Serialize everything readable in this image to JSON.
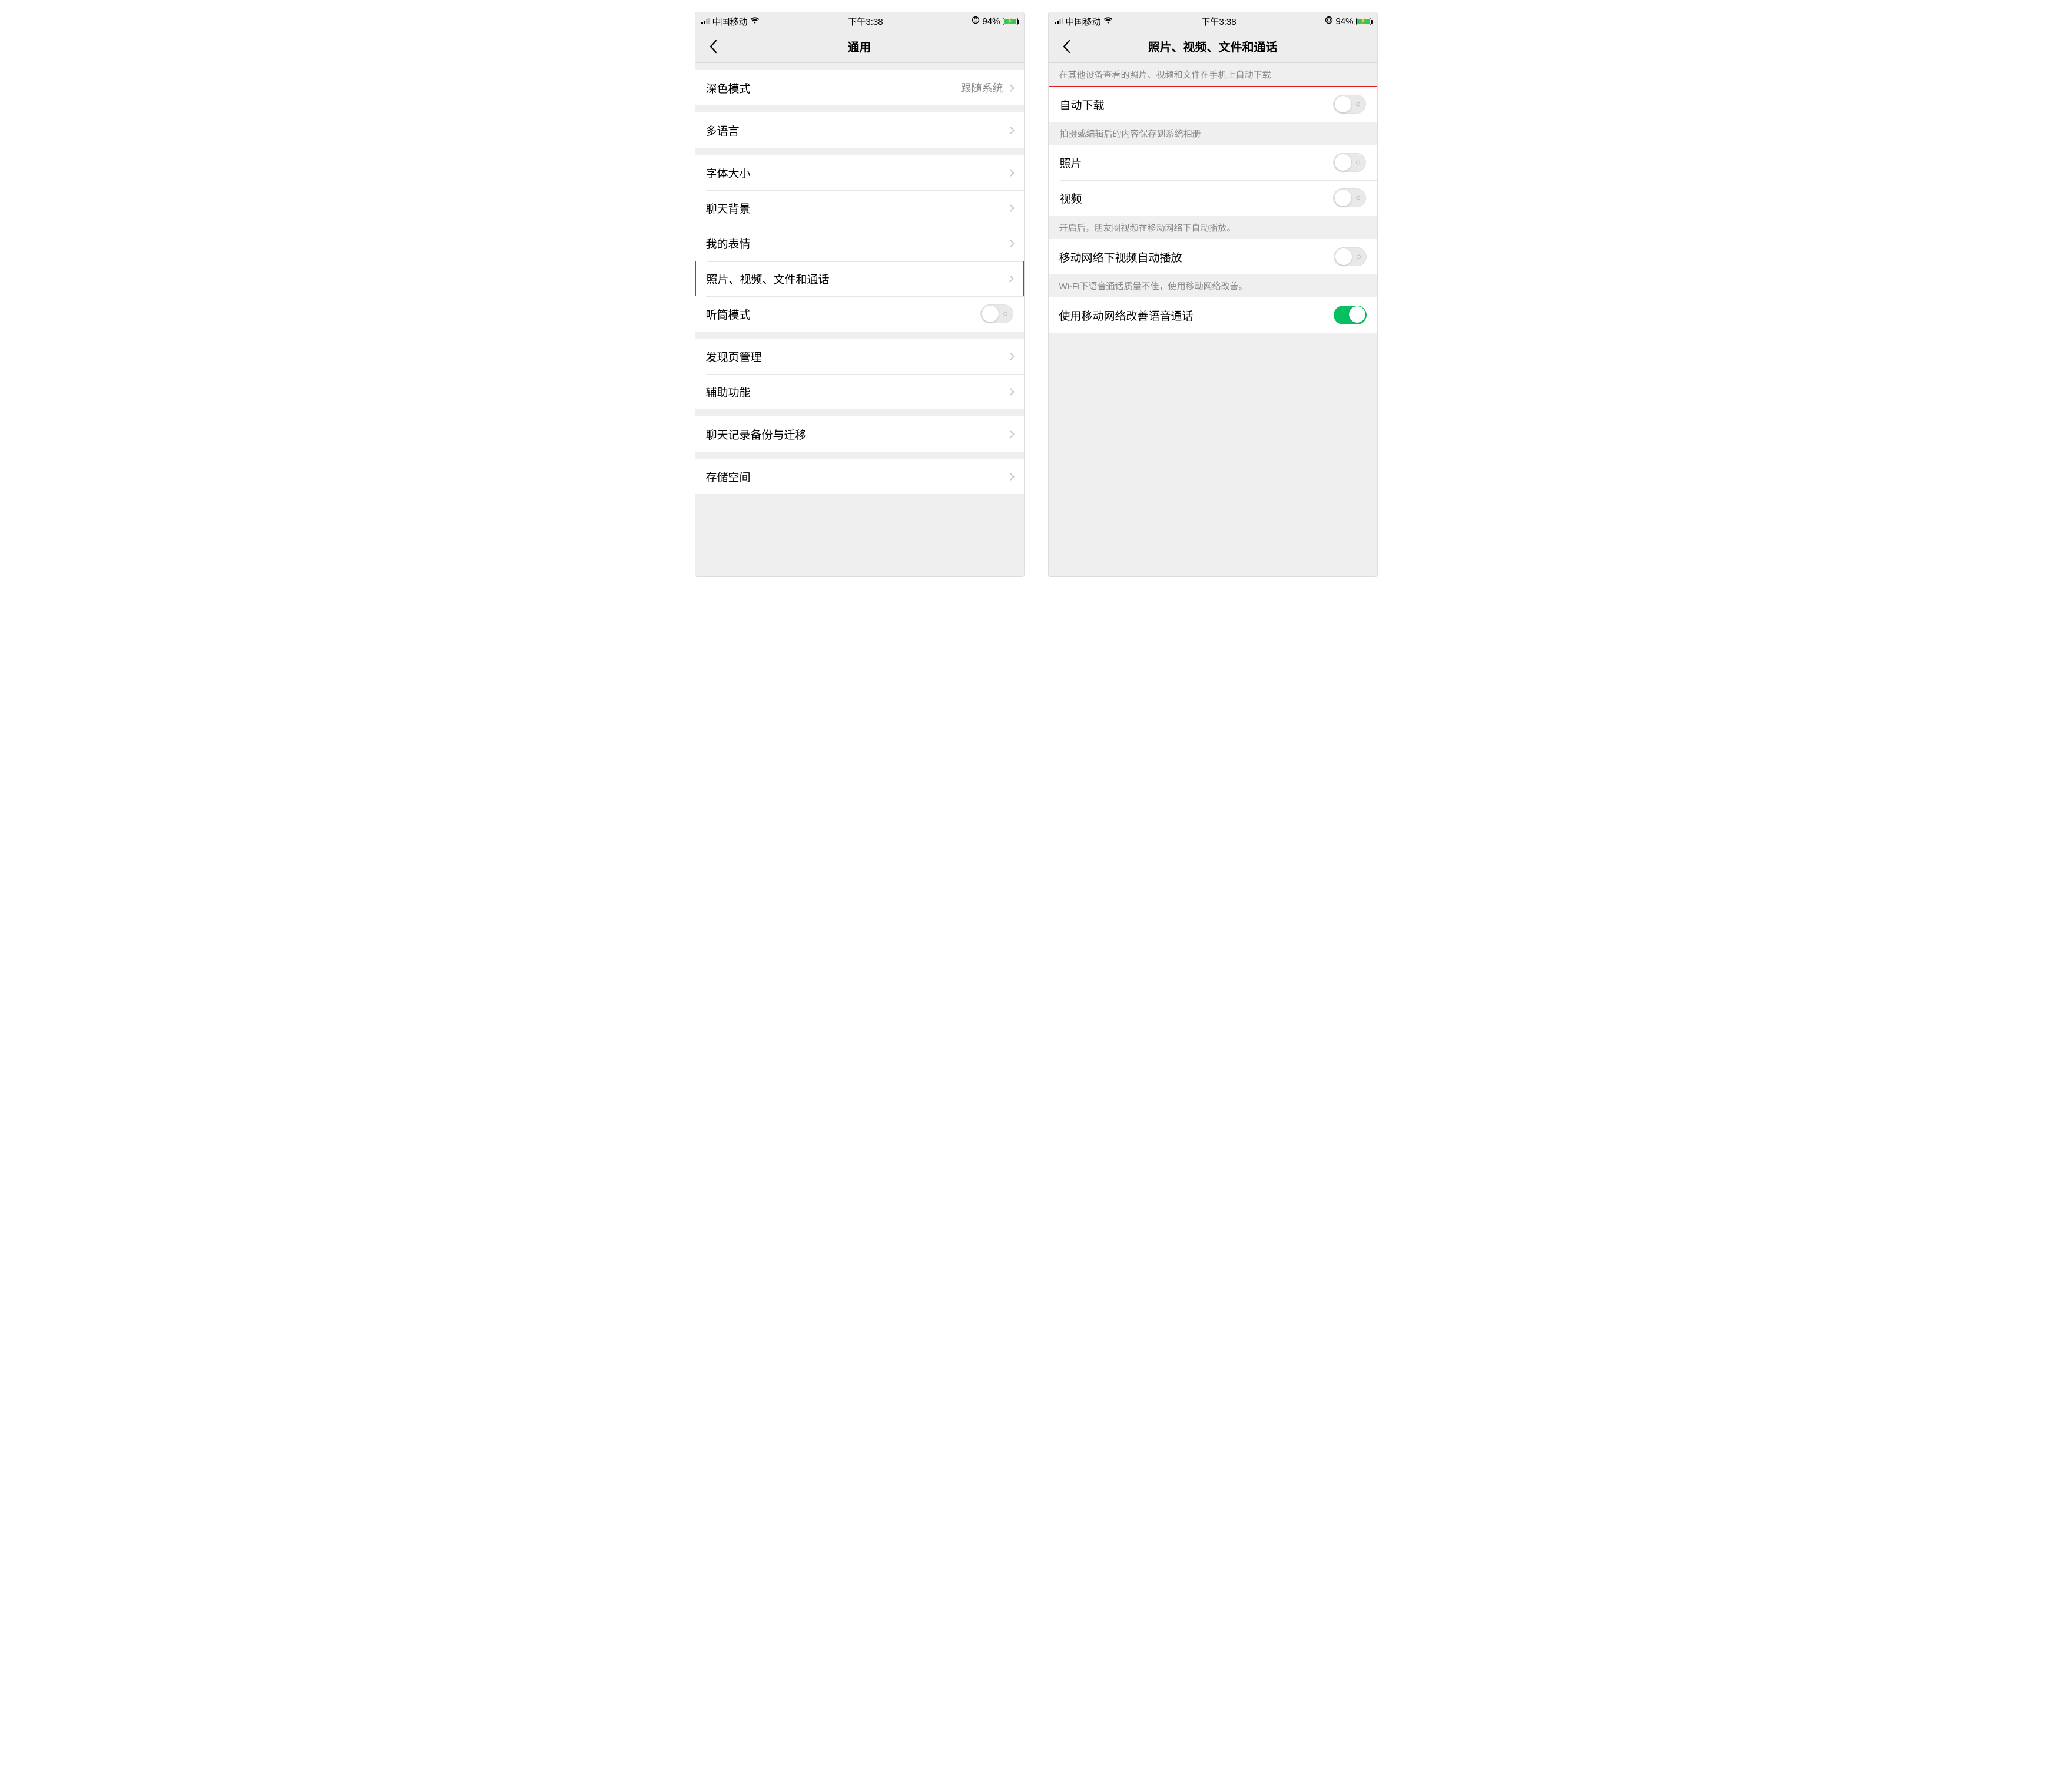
{
  "status": {
    "carrier": "中国移动",
    "time": "下午3:38",
    "battery_text": "94%"
  },
  "screen1": {
    "title": "通用",
    "rows": {
      "dark_mode": {
        "label": "深色模式",
        "value": "跟随系统"
      },
      "language": {
        "label": "多语言"
      },
      "font_size": {
        "label": "字体大小"
      },
      "chat_bg": {
        "label": "聊天背景"
      },
      "stickers": {
        "label": "我的表情"
      },
      "media_call": {
        "label": "照片、视频、文件和通话"
      },
      "earpiece": {
        "label": "听筒模式"
      },
      "discover": {
        "label": "发现页管理"
      },
      "accessibility": {
        "label": "辅助功能"
      },
      "backup": {
        "label": "聊天记录备份与迁移"
      },
      "storage": {
        "label": "存储空间"
      }
    }
  },
  "screen2": {
    "title": "照片、视频、文件和通话",
    "sections": {
      "auto_dl_hint": "在其他设备查看的照片、视频和文件在手机上自动下载",
      "auto_download": {
        "label": "自动下载"
      },
      "save_hint": "拍摄或编辑后的内容保存到系统相册",
      "photos": {
        "label": "照片"
      },
      "videos": {
        "label": "视频"
      },
      "autoplay_hint": "开启后，朋友圈视频在移动网络下自动播放。",
      "autoplay": {
        "label": "移动网络下视频自动播放"
      },
      "wifi_hint": "Wi-Fi下语音通话质量不佳，使用移动网络改善。",
      "improve_voice": {
        "label": "使用移动网络改善语音通话"
      }
    }
  }
}
